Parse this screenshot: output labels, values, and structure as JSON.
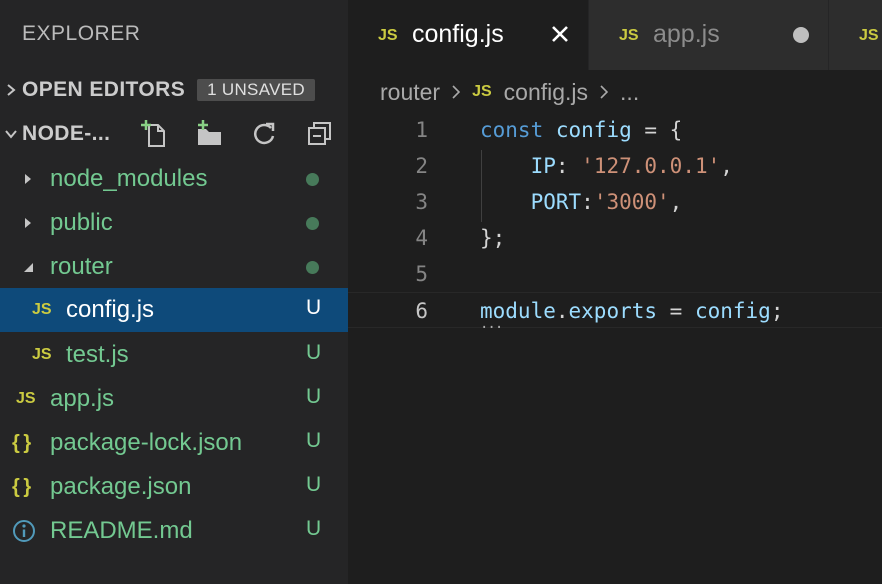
{
  "sidebar": {
    "title": "EXPLORER",
    "open_editors": {
      "label": "OPEN EDITORS",
      "badge": "1 UNSAVED"
    },
    "workspace": {
      "label": "NODE-...",
      "actions": [
        "new-file-icon",
        "new-folder-icon",
        "refresh-icon",
        "collapse-all-icon"
      ]
    },
    "tree": [
      {
        "label": "node_modules",
        "kind": "folder",
        "expanded": false,
        "status": "dot"
      },
      {
        "label": "public",
        "kind": "folder",
        "expanded": false,
        "status": "dot"
      },
      {
        "label": "router",
        "kind": "folder",
        "expanded": true,
        "status": "dot"
      },
      {
        "label": "config.js",
        "kind": "js",
        "status": "U",
        "icon": "JS",
        "selected": true
      },
      {
        "label": "test.js",
        "kind": "js",
        "status": "U",
        "icon": "JS"
      },
      {
        "label": "app.js",
        "kind": "js",
        "status": "U",
        "icon": "JS"
      },
      {
        "label": "package-lock.json",
        "kind": "json",
        "status": "U",
        "icon": "{ }"
      },
      {
        "label": "package.json",
        "kind": "json",
        "status": "U",
        "icon": "{ }"
      },
      {
        "label": "README.md",
        "kind": "info",
        "status": "U",
        "icon": "info-icon"
      }
    ]
  },
  "tabs": [
    {
      "label": "config.js",
      "icon": "JS",
      "active": true,
      "action": "close-icon"
    },
    {
      "label": "app.js",
      "icon": "JS",
      "active": false,
      "action": "unsaved-dot-icon"
    },
    {
      "label": "",
      "icon": "JS",
      "active": false
    }
  ],
  "breadcrumb": {
    "folder": "router",
    "icon": "JS",
    "file": "config.js",
    "more": "..."
  },
  "editor": {
    "lines": [
      {
        "number": "1",
        "tokens": [
          [
            "k",
            "const"
          ],
          [
            "p",
            " "
          ],
          [
            "v",
            "config"
          ],
          [
            "p",
            " = {"
          ]
        ]
      },
      {
        "number": "2",
        "tokens": [
          [
            "p",
            "    "
          ],
          [
            "v",
            "IP"
          ],
          [
            "p",
            ": "
          ],
          [
            "s",
            "'127.0.0.1'"
          ],
          [
            "p",
            ","
          ]
        ]
      },
      {
        "number": "3",
        "tokens": [
          [
            "p",
            "    "
          ],
          [
            "v",
            "PORT"
          ],
          [
            "p",
            ":"
          ],
          [
            "s",
            "'3000'"
          ],
          [
            "p",
            ","
          ]
        ]
      },
      {
        "number": "4",
        "tokens": [
          [
            "p",
            "};"
          ]
        ]
      },
      {
        "number": "5",
        "tokens": []
      },
      {
        "number": "6",
        "tokens": [
          [
            "v",
            "module"
          ],
          [
            "p",
            "."
          ],
          [
            "v",
            "exports"
          ],
          [
            "p",
            " = "
          ],
          [
            "v",
            "config"
          ],
          [
            "p",
            ";"
          ]
        ]
      }
    ],
    "current_line": "6"
  },
  "colors": {
    "sidebar_bg": "#252526",
    "editor_bg": "#1e1e1e",
    "selection_bg": "#0e4a7a",
    "git_untracked": "#73c991",
    "js_icon": "#cbcb41",
    "keyword": "#569cd6",
    "variable": "#9cdcfe",
    "string": "#ce9178"
  }
}
